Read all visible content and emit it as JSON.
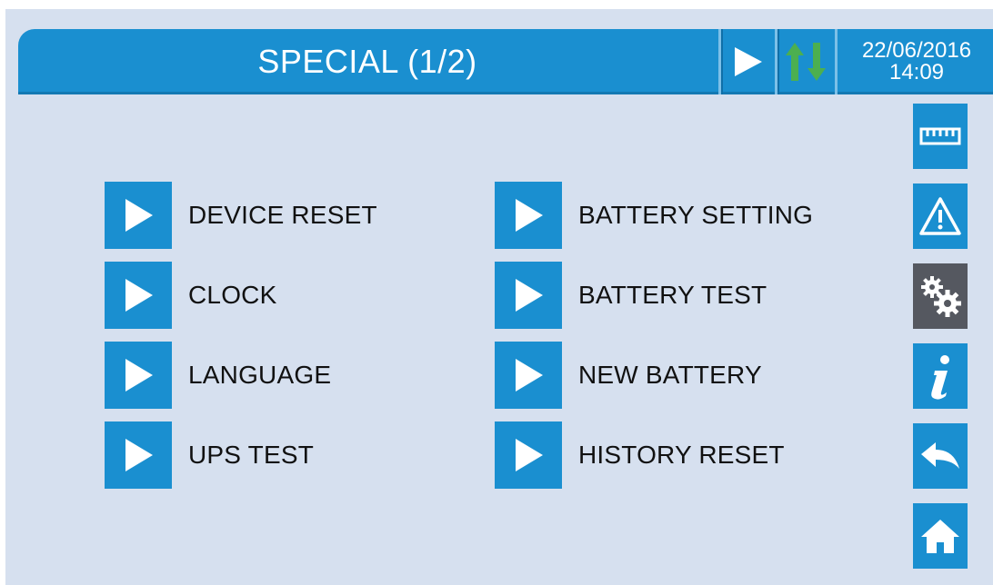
{
  "header": {
    "title": "SPECIAL (1/2)",
    "date": "22/06/2016",
    "time": "14:09"
  },
  "menu": {
    "left": [
      {
        "label": "DEVICE RESET"
      },
      {
        "label": "CLOCK"
      },
      {
        "label": "LANGUAGE"
      },
      {
        "label": "UPS TEST"
      }
    ],
    "right": [
      {
        "label": "BATTERY SETTING"
      },
      {
        "label": "BATTERY TEST"
      },
      {
        "label": "NEW BATTERY"
      },
      {
        "label": "HISTORY RESET"
      }
    ]
  },
  "sidebar": {
    "items": [
      {
        "icon": "ruler-icon",
        "active": false
      },
      {
        "icon": "warning-icon",
        "active": false
      },
      {
        "icon": "gears-icon",
        "active": true
      },
      {
        "icon": "info-icon",
        "active": false
      },
      {
        "icon": "back-arrow-icon",
        "active": false
      },
      {
        "icon": "home-icon",
        "active": false
      }
    ]
  },
  "colors": {
    "accent": "#1a8fd0",
    "background": "#d6e0ef",
    "active": "#555860",
    "comm_arrows": "#4caf50"
  }
}
